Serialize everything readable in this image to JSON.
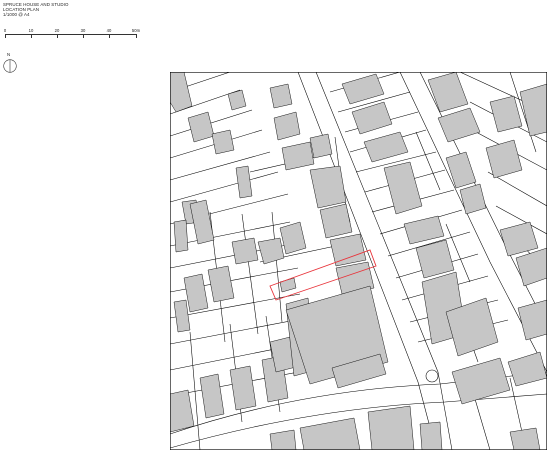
{
  "title": {
    "line1": "SPRUCE HOUSE AND STUDIO",
    "line2": "LOCATION PLAN",
    "line3": "1/1000 @ A4"
  },
  "scale": {
    "labels": [
      "0",
      "10",
      "20",
      "30",
      "40",
      "50m"
    ],
    "unit": "m"
  },
  "north": {
    "label": "N",
    "icon": "north-arrow-icon"
  },
  "map": {
    "building_color": "#c6c6c6",
    "outline_color": "#000000",
    "site_outline_color": "#e8333a"
  }
}
